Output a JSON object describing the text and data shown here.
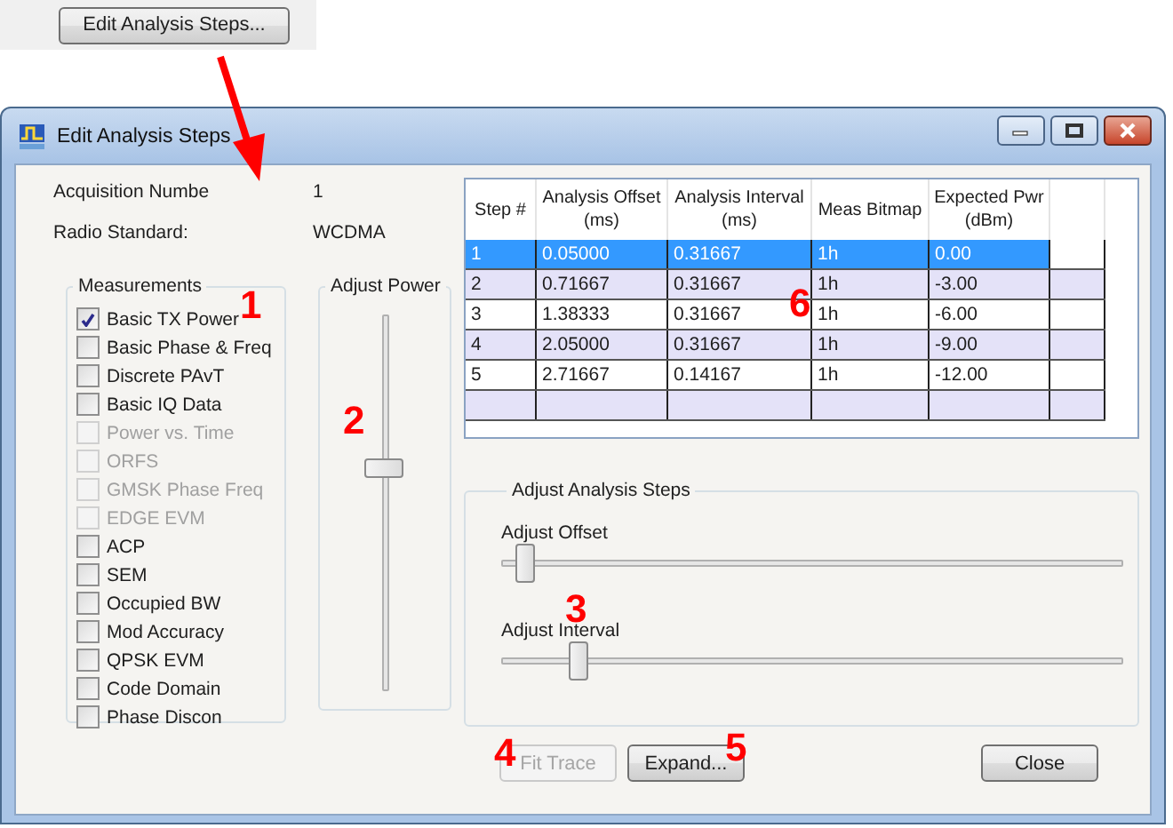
{
  "launcher_button": {
    "label": "Edit Analysis Steps..."
  },
  "window": {
    "title": "Edit Analysis Steps"
  },
  "info": [
    {
      "label": "Acquisition Numbe",
      "value": "1"
    },
    {
      "label": "Radio Standard:",
      "value": "WCDMA"
    }
  ],
  "measurements": {
    "title": "Measurements",
    "items": [
      {
        "label": "Basic TX Power",
        "checked": true,
        "disabled": false
      },
      {
        "label": "Basic Phase & Freq",
        "checked": false,
        "disabled": false
      },
      {
        "label": "Discrete PAvT",
        "checked": false,
        "disabled": false
      },
      {
        "label": "Basic IQ Data",
        "checked": false,
        "disabled": false
      },
      {
        "label": "Power vs. Time",
        "checked": false,
        "disabled": true
      },
      {
        "label": "ORFS",
        "checked": false,
        "disabled": true
      },
      {
        "label": "GMSK Phase Freq",
        "checked": false,
        "disabled": true
      },
      {
        "label": "EDGE EVM",
        "checked": false,
        "disabled": true
      },
      {
        "label": "ACP",
        "checked": false,
        "disabled": false
      },
      {
        "label": "SEM",
        "checked": false,
        "disabled": false
      },
      {
        "label": "Occupied BW",
        "checked": false,
        "disabled": false
      },
      {
        "label": "Mod Accuracy",
        "checked": false,
        "disabled": false
      },
      {
        "label": "QPSK EVM",
        "checked": false,
        "disabled": false
      },
      {
        "label": "Code Domain",
        "checked": false,
        "disabled": false
      },
      {
        "label": "Phase Discon",
        "checked": false,
        "disabled": false
      }
    ]
  },
  "adjust_power": {
    "title": "Adjust Power",
    "level": 0.6
  },
  "table": {
    "columns": [
      "Step #",
      "Analysis Offset\n(ms)",
      "Analysis Interval\n(ms)",
      "Meas Bitmap",
      "Expected Pwr\n(dBm)"
    ],
    "rows": [
      {
        "cells": [
          "1",
          "0.05000",
          "0.31667",
          "1h",
          "0.00"
        ],
        "selected": true
      },
      {
        "cells": [
          "2",
          "0.71667",
          "0.31667",
          "1h",
          "-3.00"
        ],
        "selected": false
      },
      {
        "cells": [
          "3",
          "1.38333",
          "0.31667",
          "1h",
          "-6.00"
        ],
        "selected": false
      },
      {
        "cells": [
          "4",
          "2.05000",
          "0.31667",
          "1h",
          "-9.00"
        ],
        "selected": false
      },
      {
        "cells": [
          "5",
          "2.71667",
          "0.14167",
          "1h",
          "-12.00"
        ],
        "selected": false
      }
    ]
  },
  "adjust_steps": {
    "title": "Adjust Analysis Steps",
    "sliders": [
      {
        "label": "Adjust Offset",
        "level": 0.02
      },
      {
        "label": "Adjust Interval",
        "level": 0.11
      }
    ]
  },
  "buttons": [
    {
      "label": "Fit Trace",
      "disabled": true
    },
    {
      "label": "Expand...",
      "disabled": false
    },
    {
      "label": "Close",
      "disabled": false
    }
  ],
  "annotations": [
    {
      "label": "1"
    },
    {
      "label": "2"
    },
    {
      "label": "3"
    },
    {
      "label": "4"
    },
    {
      "label": "5"
    },
    {
      "label": "6"
    }
  ]
}
